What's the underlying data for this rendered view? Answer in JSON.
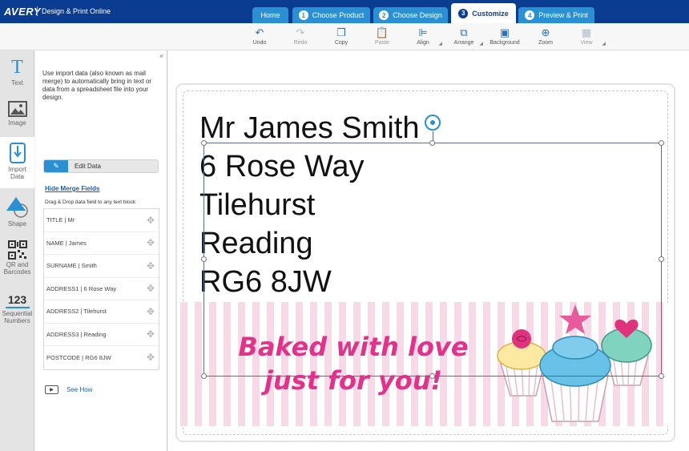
{
  "app": {
    "brand": "AVERY",
    "subtitle": "Design & Print Online"
  },
  "tabs": [
    {
      "label": "Home"
    },
    {
      "num": "1",
      "label": "Choose Product"
    },
    {
      "num": "2",
      "label": "Choose Design"
    },
    {
      "num": "3",
      "label": "Customize"
    },
    {
      "num": "4",
      "label": "Preview & Print"
    }
  ],
  "toolbar": {
    "undo": "Undo",
    "redo": "Redo",
    "copy": "Copy",
    "paste": "Paste",
    "align": "Align",
    "arrange": "Arrange",
    "background": "Background",
    "zoom": "Zoom",
    "view": "View"
  },
  "rail": {
    "text": "Text",
    "image": "Image",
    "import_line1": "Import",
    "import_line2": "Data",
    "shape": "Shape",
    "qr_line1": "QR and",
    "qr_line2": "Barcodes",
    "seq_icon": "123",
    "seq_line1": "Sequential",
    "seq_line2": "Numbers"
  },
  "panel": {
    "close": "×",
    "description": "Use import data (also known as mail merge) to automatically bring in text or data from a spreadsheet file into your design.",
    "edit_button": "Edit Data",
    "hide_link": "Hide Merge Fields",
    "drag_hint": "Drag & Drop data field to any text block",
    "fields": [
      "TITLE | Mr",
      "NAME | James",
      "SURNAME | Smith",
      "ADDRESS1 | 6 Rose Way",
      "ADDRESS2 | Tilehurst",
      "ADDRESS3 | Reading",
      "POSTCODE | RG6 8JW"
    ],
    "see_how": "See How"
  },
  "label": {
    "address_lines": [
      "Mr James Smith",
      "6 Rose Way",
      "Tilehurst",
      "Reading",
      "RG6 8JW"
    ],
    "tagline_line1": "Baked with love",
    "tagline_line2": "just for you!"
  },
  "colors": {
    "header": "#0a3d91",
    "tab": "#2b8fd3",
    "accent_pink": "#e0338c",
    "stripe": "#f9d9e7"
  }
}
